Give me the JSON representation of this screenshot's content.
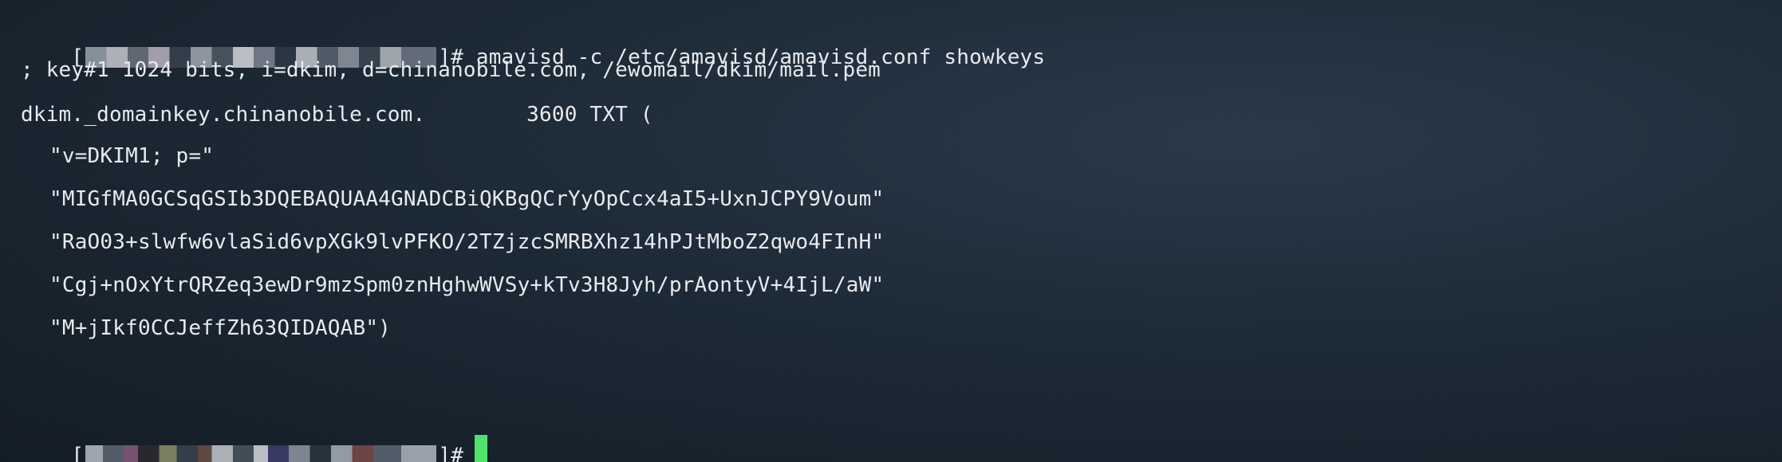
{
  "terminal": {
    "prompt_open": "[",
    "prompt_close": "]#",
    "command": " amavisd -c /etc/amavisd/amavisd.conf showkeys",
    "lines": [
      "; key#1 1024 bits, i=dkim, d=chinanobile.com, /ewomail/dkim/mail.pem",
      "dkim._domainkey.chinanobile.com.        3600 TXT (",
      "\"v=DKIM1; p=\"",
      "\"MIGfMA0GCSqGSIb3DQEBAQUAA4GNADCBiQKBgQCrYyOpCcx4aI5+UxnJCPY9Voum\"",
      "\"RaO03+slwfw6vlaSid6vpXGk9lvPFKO/2TZjzcSMRBXhz14hPJtMboZ2qwo4FInH\"",
      "\"Cgj+nOxYtrQRZeq3ewDr9mzSpm0znHghwWVSy+kTv3H8Jyh/prAontyV+4IjL/aW\"",
      "\"M+jIkf0CCJeffZh63QIDAQAB\")"
    ],
    "cursor_color": "#4ee36b",
    "background_color": "#1d2a37",
    "text_color": "#e8eaed"
  }
}
